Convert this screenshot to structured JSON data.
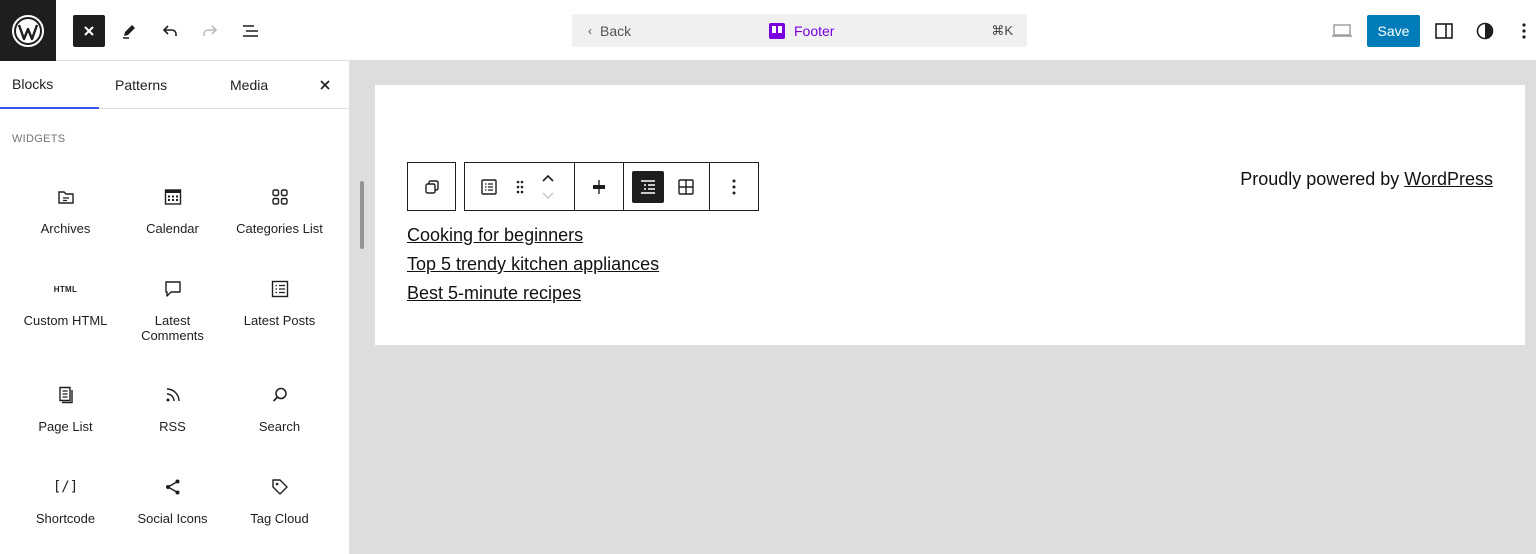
{
  "topbar": {
    "back_label": "Back",
    "document_title": "Footer",
    "shortcut": "⌘K",
    "save_label": "Save"
  },
  "sidebar": {
    "tabs": [
      {
        "label": "Blocks",
        "active": true
      },
      {
        "label": "Patterns",
        "active": false
      },
      {
        "label": "Media",
        "active": false
      }
    ],
    "section_title": "WIDGETS",
    "blocks": [
      {
        "label": "Archives",
        "icon": "archive-icon"
      },
      {
        "label": "Calendar",
        "icon": "calendar-icon"
      },
      {
        "label": "Categories List",
        "icon": "categories-icon"
      },
      {
        "label": "Custom HTML",
        "icon": "html-icon"
      },
      {
        "label": "Latest Comments",
        "icon": "comment-icon"
      },
      {
        "label": "Latest Posts",
        "icon": "posts-icon"
      },
      {
        "label": "Page List",
        "icon": "page-list-icon"
      },
      {
        "label": "RSS",
        "icon": "rss-icon"
      },
      {
        "label": "Search",
        "icon": "search-icon"
      },
      {
        "label": "Shortcode",
        "icon": "shortcode-icon"
      },
      {
        "label": "Social Icons",
        "icon": "share-icon"
      },
      {
        "label": "Tag Cloud",
        "icon": "tag-icon"
      }
    ]
  },
  "canvas": {
    "nav_links": [
      "Cooking for beginners",
      "Top 5 trendy kitchen appliances",
      "Best 5-minute recipes"
    ],
    "powered_prefix": "Proudly powered by ",
    "powered_link": "WordPress"
  },
  "colors": {
    "accent": "#007cba",
    "tab_underline": "#3858e9",
    "template_purple": "#7a00df"
  }
}
